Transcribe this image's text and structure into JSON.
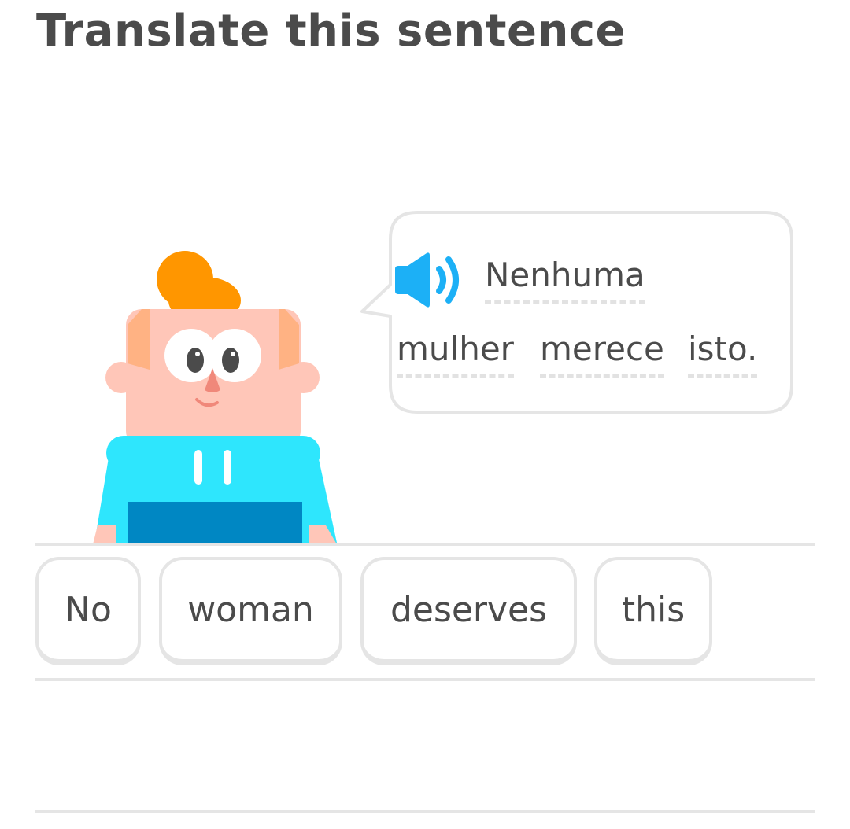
{
  "header": {
    "title": "Translate this sentence"
  },
  "prompt": {
    "speaker_icon": "speaker-icon",
    "words": [
      "Nenhuma",
      "mulher",
      "merece",
      "isto."
    ]
  },
  "word_bank": {
    "tiles": [
      "No",
      "woman",
      "deserves",
      "this"
    ]
  },
  "colors": {
    "title": "#4b4b4b",
    "speaker": "#1cb0f6",
    "border": "#e5e5e5",
    "hair": "#ff9600",
    "shirt": "#2ee6fd",
    "skin": "#ffc6b8"
  }
}
